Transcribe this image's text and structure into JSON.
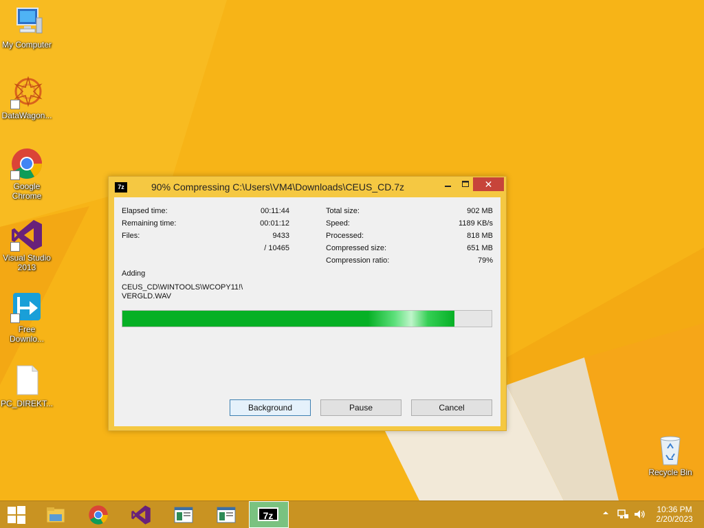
{
  "desktop": {
    "icons": [
      {
        "label": "My Computer"
      },
      {
        "label": "DataWagon..."
      },
      {
        "label": "Google Chrome"
      },
      {
        "label": "Visual Studio 2013"
      },
      {
        "label": "Free Downlo..."
      },
      {
        "label": "PC_DIREKT..."
      },
      {
        "label": "Recycle Bin"
      }
    ]
  },
  "dialog": {
    "title": "90% Compressing C:\\Users\\VM4\\Downloads\\CEUS_CD.7z",
    "close_glyph": "✕",
    "stats_left": [
      {
        "label": "Elapsed time:",
        "value": "00:11:44"
      },
      {
        "label": "Remaining time:",
        "value": "00:01:12"
      },
      {
        "label": "Files:",
        "value": "9433"
      },
      {
        "label": "",
        "value": "/ 10465"
      }
    ],
    "stats_right": [
      {
        "label": "Total size:",
        "value": "902 MB"
      },
      {
        "label": "Speed:",
        "value": "1189 KB/s"
      },
      {
        "label": "Processed:",
        "value": "818 MB"
      },
      {
        "label": "Compressed size:",
        "value": "651 MB"
      },
      {
        "label": "Compression ratio:",
        "value": "79%"
      }
    ],
    "action_label": "Adding",
    "current_file_line1": "CEUS_CD\\WINTOOLS\\WCOPY11!\\",
    "current_file_line2": "VERGLD.WAV",
    "progress_fraction": 0.9,
    "buttons": {
      "background": "Background",
      "pause": "Pause",
      "cancel": "Cancel"
    }
  },
  "taskbar": {
    "clock_time": "10:36 PM",
    "clock_date": "2/20/2023",
    "active_app_label": "7z"
  },
  "colors": {
    "desktop_bg": "#f7b417",
    "progress_green": "#06b025",
    "close_red": "#c7443a"
  }
}
